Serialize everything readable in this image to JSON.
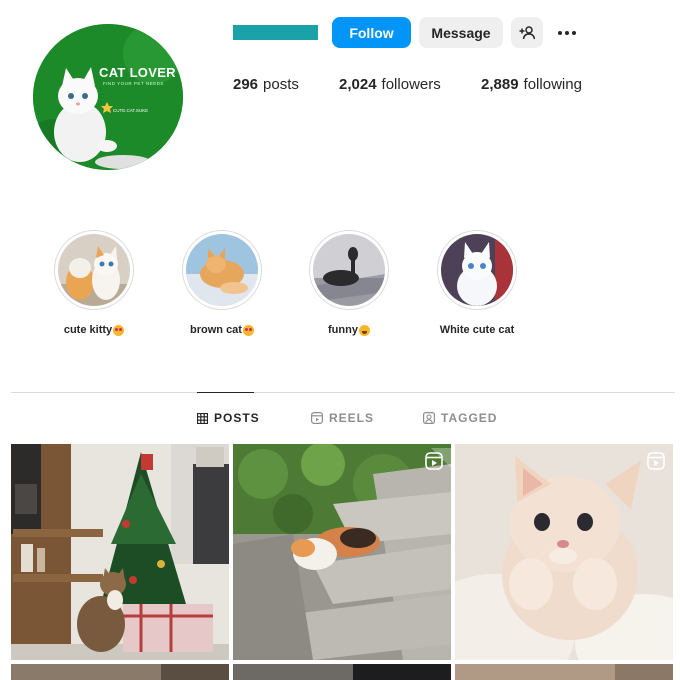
{
  "profile": {
    "avatar": {
      "title": "CAT LOVER",
      "subtitle": "FIND YOUR PET NEEDS",
      "handle": "CUTE.CAT.SUKE"
    },
    "username_redacted_color": "#1ba2a8",
    "buttons": {
      "follow": "Follow",
      "message": "Message"
    },
    "stats": {
      "posts_count": "296",
      "posts_label": "posts",
      "followers_count": "2,024",
      "followers_label": "followers",
      "following_count": "2,889",
      "following_label": "following"
    }
  },
  "highlights": [
    {
      "label": "cute kitty",
      "emoji": "heart-eyes-emoji"
    },
    {
      "label": "brown cat",
      "emoji": "heart-eyes-emoji"
    },
    {
      "label": "funny",
      "emoji": "laughing-emoji"
    },
    {
      "label": "White cute cat",
      "emoji": ""
    }
  ],
  "tabs": [
    {
      "label": "POSTS",
      "icon": "grid-icon",
      "active": true
    },
    {
      "label": "REELS",
      "icon": "reels-icon",
      "active": false
    },
    {
      "label": "TAGGED",
      "icon": "tagged-icon",
      "active": false
    }
  ],
  "colors": {
    "primary_button": "#0095f6",
    "secondary_button": "#efefef",
    "avatar_background": "#1c8a28",
    "muted_text": "#8e8e8e"
  }
}
